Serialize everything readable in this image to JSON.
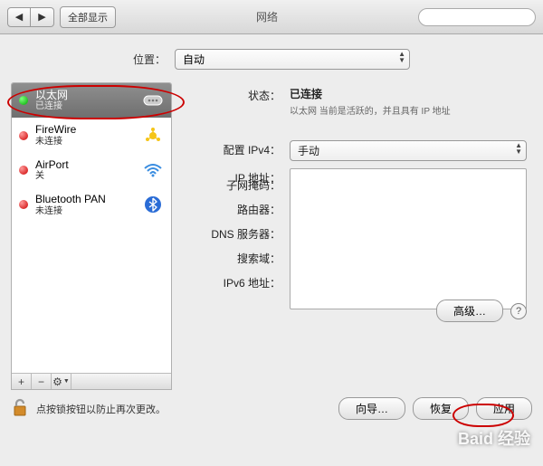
{
  "toolbar": {
    "show_all": "全部显示",
    "title": "网络"
  },
  "location": {
    "label": "位置：",
    "value": "自动"
  },
  "sidebar": {
    "items": [
      {
        "title": "以太网",
        "sub": "已连接",
        "status": "green",
        "icon_svg": "dots"
      },
      {
        "title": "FireWire",
        "sub": "未连接",
        "status": "red",
        "icon_svg": "firewire"
      },
      {
        "title": "AirPort",
        "sub": "关",
        "status": "red",
        "icon_svg": "wifi"
      },
      {
        "title": "Bluetooth PAN",
        "sub": "未连接",
        "status": "red",
        "icon_svg": "bluetooth"
      }
    ],
    "footer": {
      "add": "+",
      "remove": "−",
      "gear": "⚙"
    }
  },
  "detail": {
    "status_label": "状态：",
    "status_value": "已连接",
    "status_note": "以太网 当前是活跃的，并且具有 IP 地址",
    "config_label": "配置 IPv4：",
    "config_value": "手动",
    "fields": [
      "IP 地址：",
      "子网掩码：",
      "路由器：",
      "DNS 服务器：",
      "搜索域：",
      "IPv6 地址："
    ],
    "advanced": "高级…"
  },
  "bottom": {
    "lock_text": "点按锁按钮以防止再次更改。",
    "wizard": "向导…",
    "revert": "恢复",
    "apply": "应用"
  },
  "watermark": "Baid 经验"
}
